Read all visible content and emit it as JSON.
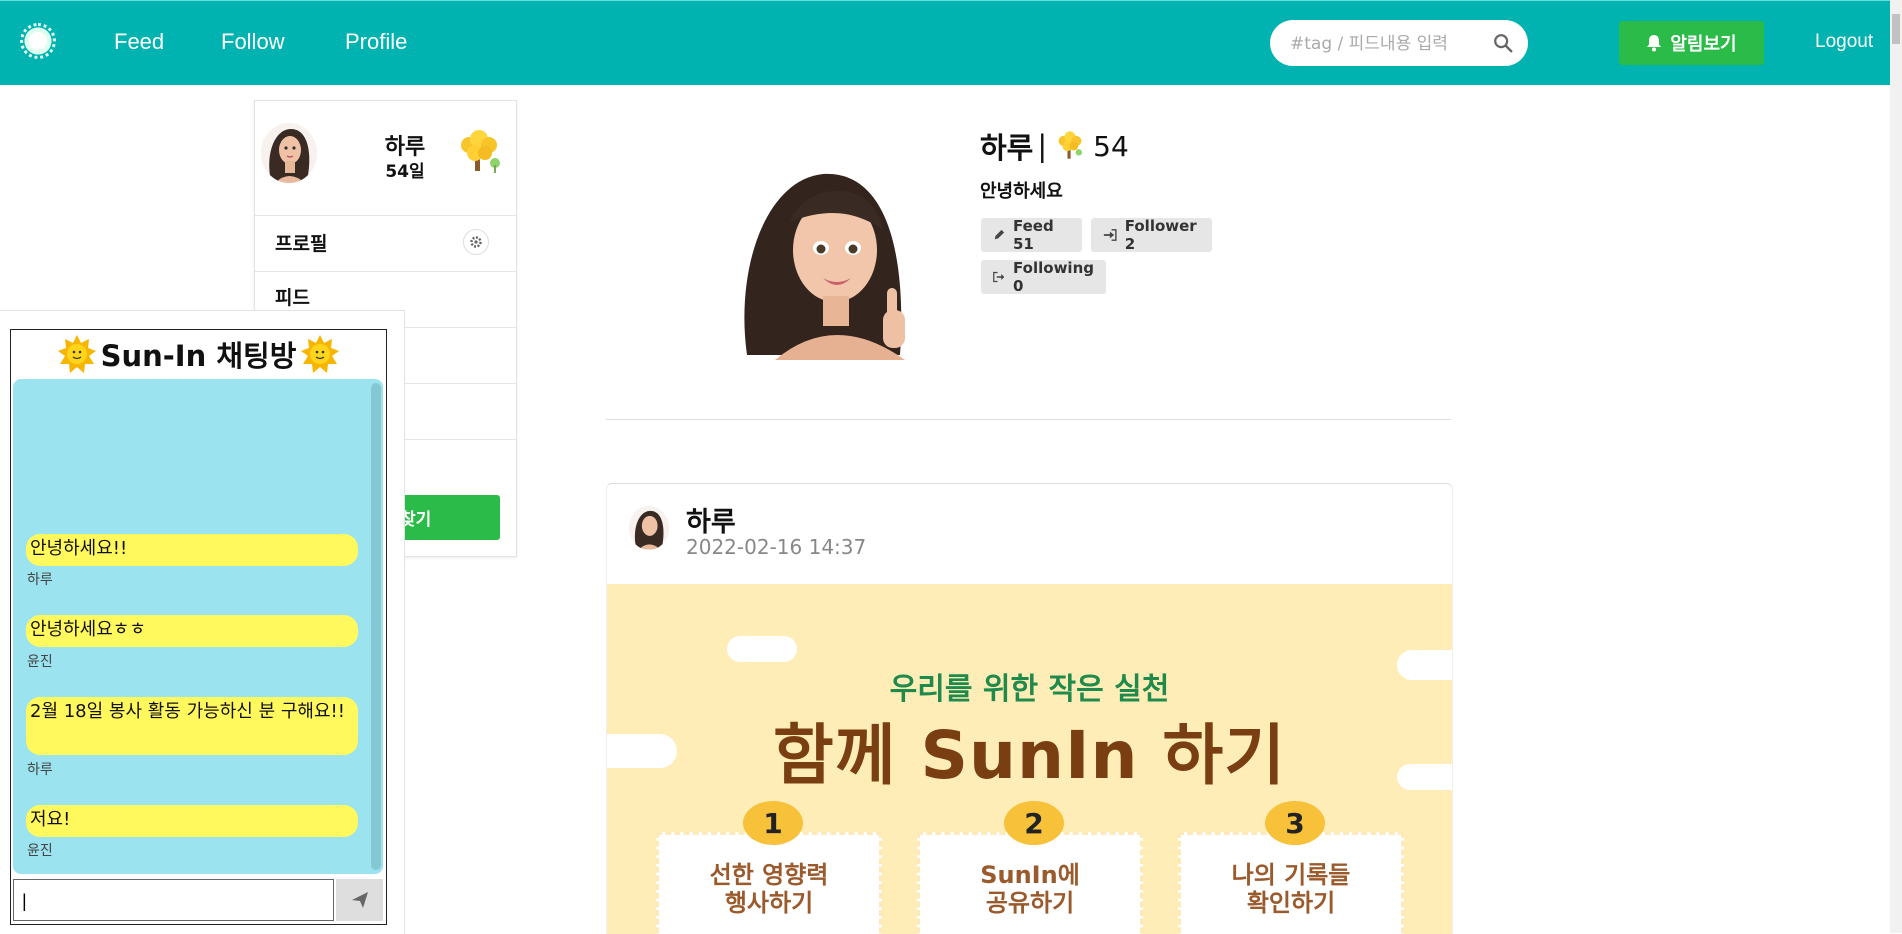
{
  "nav": {
    "links": [
      "Feed",
      "Follow",
      "Profile"
    ],
    "search_placeholder": "#tag / 피드내용 입력",
    "alarm_label": "알림보기",
    "logout_label": "Logout"
  },
  "card": {
    "name": "하루",
    "days": "54일",
    "menu": [
      "프로필",
      "피드"
    ],
    "button_label": "찾기"
  },
  "chat": {
    "title": "Sun-In 채팅방",
    "messages": [
      {
        "text": "안녕하세요!!",
        "author": "하루"
      },
      {
        "text": "안녕하세요ㅎㅎ",
        "author": "윤진"
      },
      {
        "text": "2월 18일 봉사 활동 가능하신 분 구해요!!",
        "author": "하루"
      },
      {
        "text": "저요!",
        "author": "윤진"
      }
    ],
    "input_value": "|"
  },
  "profile": {
    "name": "하루",
    "separator": "|",
    "level": "54",
    "greeting": "안녕하세요",
    "feed_label": "Feed 51",
    "follower_label": "Follower 2",
    "following_label": "Following 0"
  },
  "post": {
    "author": "하루",
    "date": "2022-02-16 14:37",
    "image": {
      "subtitle": "우리를 위한 작은 실천",
      "title": "함께 SunIn 하기",
      "steps": [
        {
          "num": "1",
          "text": "선한 영향력\n행사하기"
        },
        {
          "num": "2",
          "text": "SunIn에\n공유하기"
        },
        {
          "num": "3",
          "text": "나의 기록들\n확인하기"
        }
      ]
    }
  },
  "colors": {
    "nav": "#00b3b0",
    "green_button": "#2bbb48",
    "chat_bg": "#9be3ef",
    "chat_bubble": "#fff95e",
    "poster_bg": "#feedb6"
  }
}
